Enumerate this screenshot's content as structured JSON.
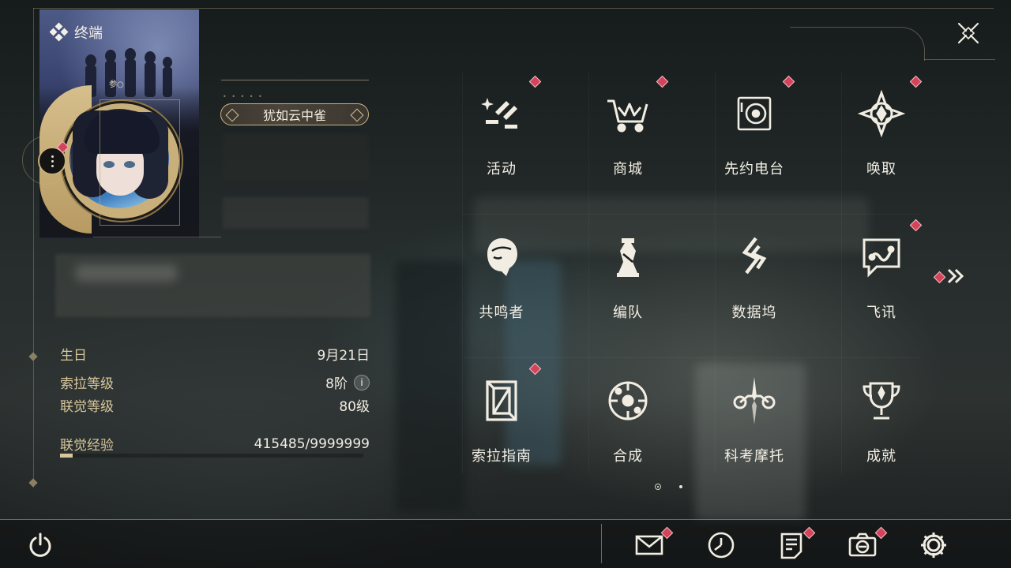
{
  "header": {
    "title": "终端"
  },
  "profile": {
    "name": "犹如云中雀",
    "card_caption": "参○"
  },
  "stats": [
    {
      "label": "生日",
      "value": "9月21日"
    },
    {
      "label": "索拉等级",
      "value": "8阶"
    },
    {
      "label": "联觉等级",
      "value": "80级"
    },
    {
      "label": "联觉经验",
      "value": "415485/9999999"
    }
  ],
  "xp_fraction": 0.042,
  "menu": [
    {
      "label": "活动",
      "icon": "event-icon",
      "badge": true
    },
    {
      "label": "商城",
      "icon": "shop-cart-icon",
      "badge": true
    },
    {
      "label": "先约电台",
      "icon": "radio-icon",
      "badge": true
    },
    {
      "label": "唤取",
      "icon": "convene-icon",
      "badge": true
    },
    {
      "label": "共鸣者",
      "icon": "resonator-icon",
      "badge": false
    },
    {
      "label": "编队",
      "icon": "team-icon",
      "badge": false
    },
    {
      "label": "数据坞",
      "icon": "data-bank-icon",
      "badge": false
    },
    {
      "label": "飞讯",
      "icon": "message-icon",
      "badge": true
    },
    {
      "label": "索拉指南",
      "icon": "guidebook-icon",
      "badge": true
    },
    {
      "label": "合成",
      "icon": "synthesis-icon",
      "badge": false
    },
    {
      "label": "科考摩托",
      "icon": "motorcycle-icon",
      "badge": false
    },
    {
      "label": "成就",
      "icon": "trophy-icon",
      "badge": false
    }
  ],
  "pagination": {
    "current": 1,
    "total": 2
  },
  "bottom_bar": [
    {
      "icon": "mail-icon",
      "badge": true
    },
    {
      "icon": "clock-icon",
      "badge": false
    },
    {
      "icon": "notes-icon",
      "badge": true
    },
    {
      "icon": "camera-icon",
      "badge": true
    },
    {
      "icon": "gear-icon",
      "badge": false
    }
  ],
  "colors": {
    "accent_gold": "#d8c79b",
    "badge_red": "#d3445a",
    "text_light": "#f3efe5"
  }
}
